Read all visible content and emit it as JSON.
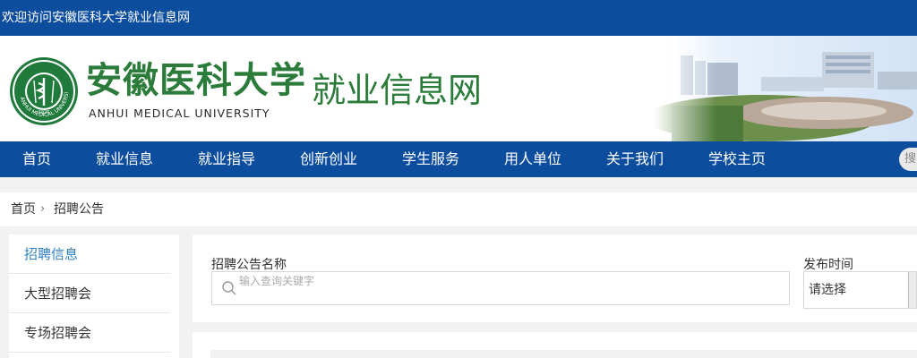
{
  "topbar": {
    "welcome": "欢迎访问安徽医科大学就业信息网"
  },
  "header": {
    "university_cn": "安徽医科大学",
    "university_en": "ANHUI MEDICAL UNIVERSITY",
    "site_name": "就业信息网",
    "logo": {
      "icon": "university-seal-icon",
      "ring_text_en": "ANHUI MEDICAL UNIVERSITY",
      "year": "1926"
    }
  },
  "nav": {
    "items": [
      "首页",
      "就业信息",
      "就业指导",
      "创新创业",
      "学生服务",
      "用人单位",
      "关于我们",
      "学校主页"
    ],
    "search_text": "搜"
  },
  "breadcrumb": {
    "home": "首页",
    "separator": "›",
    "current": "招聘公告"
  },
  "sidebar": {
    "items": [
      {
        "label": "招聘信息",
        "active": true
      },
      {
        "label": "大型招聘会",
        "active": false
      },
      {
        "label": "专场招聘会",
        "active": false
      }
    ]
  },
  "filter": {
    "name_label": "招聘公告名称",
    "search_placeholder": "输入查询关键字",
    "search_value": "",
    "date_label": "发布时间",
    "date_value": "请选择"
  },
  "colors": {
    "primary": "#0c4d9e",
    "brand_green": "#2b7b3a",
    "active_link": "#2f7fc6"
  }
}
